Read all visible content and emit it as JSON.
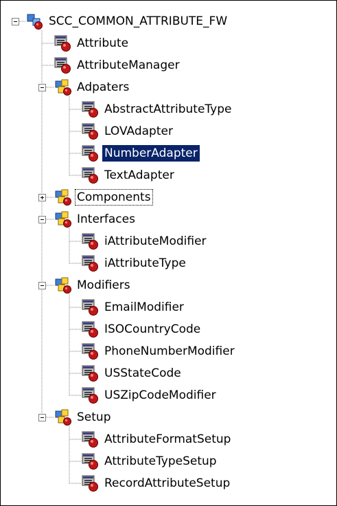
{
  "colors": {
    "selection": "#0a246a",
    "connector": "#808080",
    "border": "#000000"
  },
  "tree": {
    "root": {
      "label": "SCC_COMMON_ATTRIBUTE_FW",
      "icon": "package-root-icon",
      "expanded": true
    },
    "nodes": [
      {
        "label": "Attribute",
        "icon": "class-icon"
      },
      {
        "label": "AttributeManager",
        "icon": "class-icon"
      },
      {
        "label": "Adpaters",
        "icon": "package-icon",
        "expanded": true,
        "children": [
          {
            "label": "AbstractAttributeType",
            "icon": "class-icon"
          },
          {
            "label": "LOVAdapter",
            "icon": "class-icon"
          },
          {
            "label": "NumberAdapter",
            "icon": "class-icon",
            "selected": true
          },
          {
            "label": "TextAdapter",
            "icon": "class-icon"
          }
        ]
      },
      {
        "label": "Components",
        "icon": "package-icon",
        "expanded": false,
        "focused": true
      },
      {
        "label": "Interfaces",
        "icon": "package-icon",
        "expanded": true,
        "children": [
          {
            "label": "iAttributeModifier",
            "icon": "class-icon"
          },
          {
            "label": "iAttributeType",
            "icon": "class-icon"
          }
        ]
      },
      {
        "label": "Modifiers",
        "icon": "package-icon",
        "expanded": true,
        "children": [
          {
            "label": "EmailModifier",
            "icon": "class-icon"
          },
          {
            "label": "ISOCountryCode",
            "icon": "class-icon"
          },
          {
            "label": "PhoneNumberModifier",
            "icon": "class-icon"
          },
          {
            "label": "USStateCode",
            "icon": "class-icon"
          },
          {
            "label": "USZipCodeModifier",
            "icon": "class-icon"
          }
        ]
      },
      {
        "label": "Setup",
        "icon": "package-icon",
        "expanded": true,
        "children": [
          {
            "label": "AttributeFormatSetup",
            "icon": "class-icon"
          },
          {
            "label": "AttributeTypeSetup",
            "icon": "class-icon"
          },
          {
            "label": "RecordAttributeSetup",
            "icon": "class-icon"
          }
        ]
      }
    ]
  }
}
